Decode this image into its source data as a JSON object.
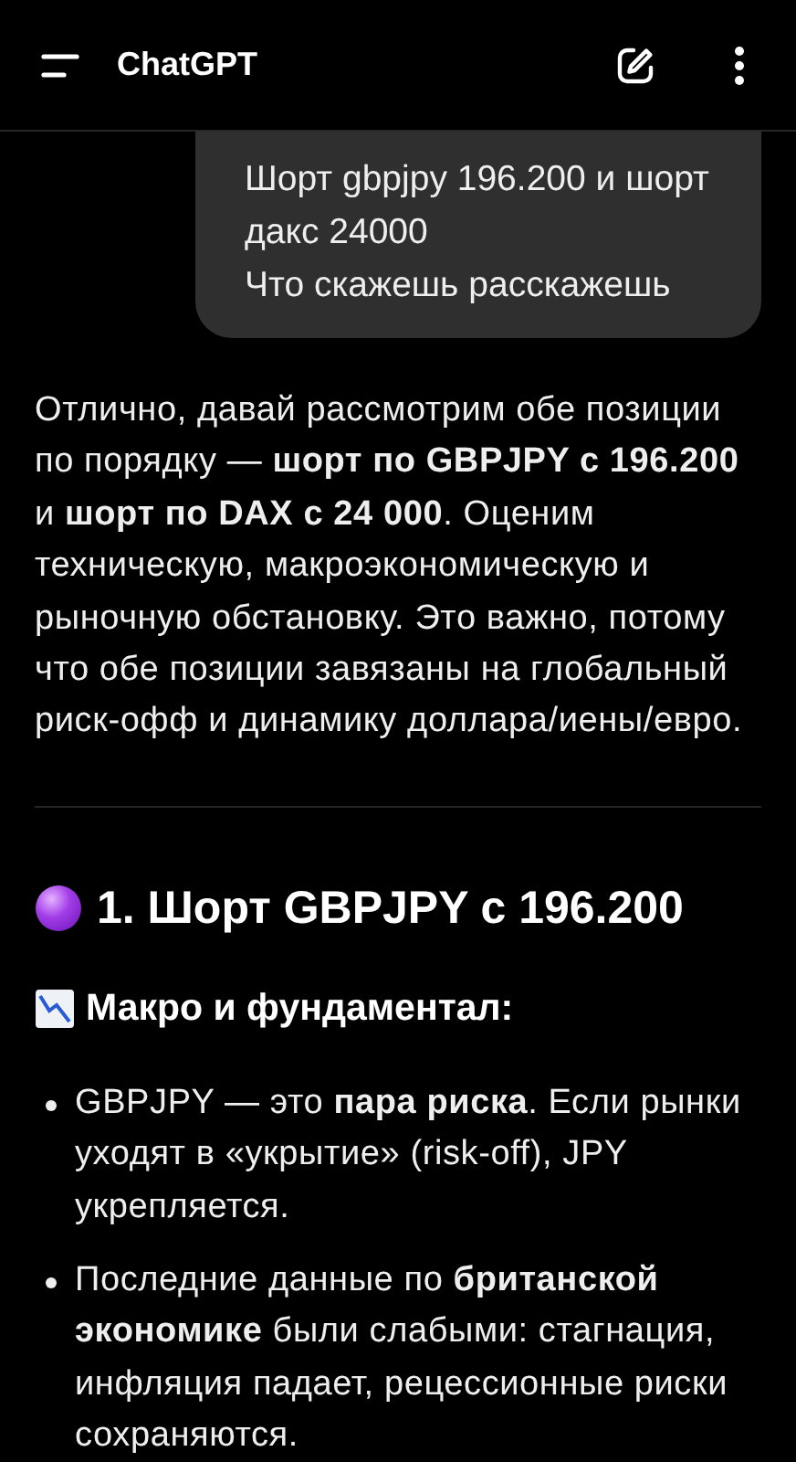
{
  "header": {
    "title": "ChatGPT"
  },
  "user_message": {
    "lines": [
      "Шорт gbpjpy 196.200 и шорт",
      "дакс 24000",
      "Что скажешь расскажешь"
    ]
  },
  "answer": {
    "intro": "Отлично, давай рассмотрим обе позиции по порядку — **шорт по GBPJPY с 196.200** и **шорт по DAX с 24 000**. Оценим техническую, макроэкономическую и рыночную обстановку. Это важно, потому что обе позиции завязаны на глобальный риск-офф и динамику доллара/иены/евро.",
    "heading": "1. Шорт GBPJPY с 196.200",
    "subheading": "Макро и фундаментал:",
    "bullets": [
      "GBPJPY — это **пара риска**. Если рынки уходят в «укрытие» (risk-off), JPY укрепляется.",
      "Последние данные по **британской экономике** были слабыми: стагнация, инфляция падает, рецессионные риски сохраняются."
    ]
  }
}
